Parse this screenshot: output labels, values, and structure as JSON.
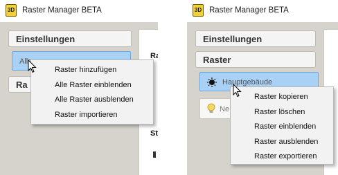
{
  "left_window": {
    "title": "Raster Manager BETA",
    "app_icon_text": "3D",
    "settings_button": "Einstellungen",
    "selected_item": "Alle",
    "partial_button": "Ra",
    "panel_heading_partial": "Ra",
    "panel_heading2_partial": "St",
    "context_menu": [
      "Raster hinzufügen",
      "Alle Raster einblenden",
      "Alle Raster ausblenden",
      "Raster importieren"
    ]
  },
  "right_window": {
    "title": "Raster Manager BETA",
    "app_icon_text": "3D",
    "settings_button": "Einstellungen",
    "raster_button": "Raster",
    "selected_item": "Hauptgebäude",
    "second_item_partial": "Ne",
    "context_menu": [
      "Raster kopieren",
      "Raster löschen",
      "Raster einblenden",
      "Raster ausblenden",
      "Raster exportieren"
    ]
  }
}
